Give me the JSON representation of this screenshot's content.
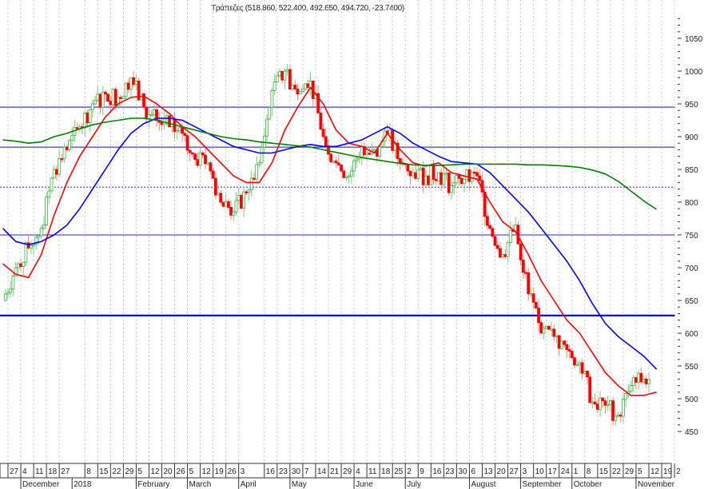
{
  "chart_data": {
    "type": "candlestick",
    "title": "Τράπεζες (518.860, 522.400, 492.650, 494.720, -23.7400)",
    "ylim": [
      440,
      1070
    ],
    "y_ticks": [
      450,
      500,
      550,
      600,
      650,
      700,
      750,
      800,
      850,
      900,
      950,
      1000,
      1050
    ],
    "weekly_close": [
      650,
      700,
      730,
      760,
      850,
      880,
      915,
      950,
      965,
      960,
      990,
      945,
      925,
      915,
      905,
      865,
      860,
      800,
      785,
      815,
      860,
      970,
      1000,
      965,
      985,
      900,
      860,
      840,
      885,
      880,
      905,
      860,
      845,
      840,
      845,
      825,
      835,
      840,
      760,
      720,
      765,
      660,
      600,
      595,
      575,
      555,
      495,
      490,
      475,
      520,
      530,
      495
    ],
    "series": [
      {
        "name": "MA short",
        "color": "#ff0000",
        "values": [
          706,
          690,
          685,
          720,
          780,
          830,
          870,
          900,
          930,
          950,
          960,
          962,
          950,
          935,
          915,
          900,
          880,
          860,
          840,
          830,
          830,
          860,
          910,
          945,
          975,
          950,
          910,
          890,
          885,
          875,
          905,
          880,
          860,
          855,
          860,
          845,
          840,
          835,
          800,
          770,
          755,
          720,
          680,
          650,
          620,
          600,
          570,
          540,
          520,
          505,
          505,
          510
        ]
      },
      {
        "name": "MA medium",
        "color": "#0000ff",
        "values": [
          760,
          740,
          735,
          740,
          750,
          765,
          790,
          820,
          850,
          880,
          905,
          920,
          928,
          928,
          925,
          915,
          905,
          895,
          885,
          880,
          875,
          875,
          880,
          885,
          888,
          885,
          885,
          890,
          895,
          905,
          915,
          905,
          890,
          880,
          870,
          862,
          860,
          858,
          845,
          825,
          805,
          785,
          760,
          735,
          710,
          680,
          645,
          615,
          595,
          580,
          565,
          545
        ]
      },
      {
        "name": "MA long",
        "color": "#008000",
        "values": [
          895,
          893,
          890,
          892,
          900,
          905,
          912,
          918,
          922,
          925,
          928,
          928,
          925,
          920,
          915,
          910,
          905,
          900,
          897,
          895,
          892,
          890,
          888,
          886,
          884,
          880,
          876,
          872,
          868,
          865,
          862,
          859,
          857,
          856,
          856,
          857,
          858,
          858,
          858,
          858,
          858,
          857,
          857,
          856,
          855,
          853,
          849,
          843,
          832,
          817,
          802,
          789
        ]
      }
    ],
    "horizontal_lines": [
      {
        "value": 945,
        "color": "#2020ff",
        "style": "solid"
      },
      {
        "value": 884,
        "color": "#1010c0",
        "style": "solid"
      },
      {
        "value": 823,
        "color": "#4040ff",
        "style": "dotted"
      },
      {
        "value": 750,
        "color": "#2020ff",
        "style": "solid"
      },
      {
        "value": 627,
        "color": "#0000ff",
        "style": "thick"
      }
    ],
    "x_day_ticks": [
      {
        "label": "27",
        "week": 0
      },
      {
        "label": "4",
        "week": 1
      },
      {
        "label": "11",
        "week": 2
      },
      {
        "label": "18",
        "week": 3
      },
      {
        "label": "27",
        "week": 4
      },
      {
        "label": "8",
        "week": 6
      },
      {
        "label": "15",
        "week": 7
      },
      {
        "label": "22",
        "week": 8
      },
      {
        "label": "29",
        "week": 9
      },
      {
        "label": "5",
        "week": 10
      },
      {
        "label": "12",
        "week": 11
      },
      {
        "label": "20",
        "week": 12
      },
      {
        "label": "26",
        "week": 13
      },
      {
        "label": "5",
        "week": 14
      },
      {
        "label": "12",
        "week": 15
      },
      {
        "label": "19",
        "week": 16
      },
      {
        "label": "26",
        "week": 17
      },
      {
        "label": "3",
        "week": 18
      },
      {
        "label": "16",
        "week": 20
      },
      {
        "label": "23",
        "week": 21
      },
      {
        "label": "30",
        "week": 22
      },
      {
        "label": "7",
        "week": 23
      },
      {
        "label": "14",
        "week": 24
      },
      {
        "label": "21",
        "week": 25
      },
      {
        "label": "29",
        "week": 26
      },
      {
        "label": "4",
        "week": 27
      },
      {
        "label": "11",
        "week": 28
      },
      {
        "label": "18",
        "week": 29
      },
      {
        "label": "25",
        "week": 30
      },
      {
        "label": "2",
        "week": 31
      },
      {
        "label": "9",
        "week": 32
      },
      {
        "label": "16",
        "week": 33
      },
      {
        "label": "23",
        "week": 34
      },
      {
        "label": "30",
        "week": 35
      },
      {
        "label": "6",
        "week": 36
      },
      {
        "label": "13",
        "week": 37
      },
      {
        "label": "20",
        "week": 38
      },
      {
        "label": "27",
        "week": 39
      },
      {
        "label": "3",
        "week": 40
      },
      {
        "label": "10",
        "week": 41
      },
      {
        "label": "17",
        "week": 42
      },
      {
        "label": "24",
        "week": 43
      },
      {
        "label": "1",
        "week": 44
      },
      {
        "label": "8",
        "week": 45
      },
      {
        "label": "15",
        "week": 46
      },
      {
        "label": "22",
        "week": 47
      },
      {
        "label": "29",
        "week": 48
      },
      {
        "label": "5",
        "week": 49
      },
      {
        "label": "12",
        "week": 50
      },
      {
        "label": "19",
        "week": 51
      },
      {
        "label": "2",
        "week": 52
      }
    ],
    "x_months": [
      {
        "label": "December",
        "week": 1
      },
      {
        "label": "2018",
        "week": 5
      },
      {
        "label": "February",
        "week": 10
      },
      {
        "label": "March",
        "week": 14
      },
      {
        "label": "April",
        "week": 18
      },
      {
        "label": "May",
        "week": 22
      },
      {
        "label": "June",
        "week": 27
      },
      {
        "label": "July",
        "week": 31
      },
      {
        "label": "August",
        "week": 36
      },
      {
        "label": "September",
        "week": 40
      },
      {
        "label": "October",
        "week": 44
      },
      {
        "label": "November",
        "week": 49
      }
    ],
    "colors": {
      "up": "#3cb043",
      "down": "#ff0000",
      "grid": "#c8c8c8"
    }
  }
}
